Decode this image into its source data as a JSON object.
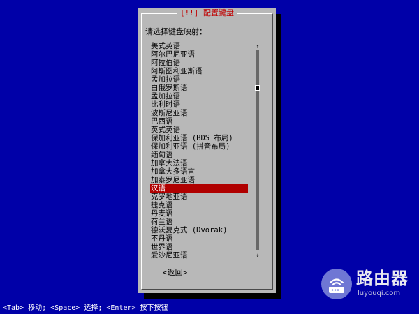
{
  "dialog": {
    "title": "[!!] 配置键盘",
    "prompt": "请选择键盘映射：",
    "keymaps": [
      "美式英语",
      "阿尔巴尼亚语",
      "阿拉伯语",
      "阿斯图利亚斯语",
      "孟加拉语",
      "白俄罗斯语",
      "孟加拉语",
      "比利时语",
      "波斯尼亚语",
      "巴西语",
      "英式英语",
      "保加利亚语 (BDS 布局)",
      "保加利亚语 (拼音布局)",
      "缅甸语",
      "加拿大法语",
      "加拿大多语言",
      "加泰罗尼亚语",
      "汉语",
      "克罗地亚语",
      "捷克语",
      "丹麦语",
      "荷兰语",
      "德沃夏克式 (Dvorak)",
      "不丹语",
      "世界语",
      "爱沙尼亚语"
    ],
    "selected_index": 17,
    "scroll_up_arrow": "↑",
    "scroll_down_arrow": "↓",
    "back_label": "<返回>"
  },
  "status_bar": {
    "help_text": "<Tab> 移动; <Space> 选择; <Enter> 按下按钮"
  },
  "watermark": {
    "name": "路由器",
    "url": "luyouqi.com",
    "icon": "router-icon"
  },
  "colors": {
    "background": "#0000a8",
    "dialog": "#b8b8b8",
    "title_text": "#c00000",
    "selection": "#b00000"
  }
}
